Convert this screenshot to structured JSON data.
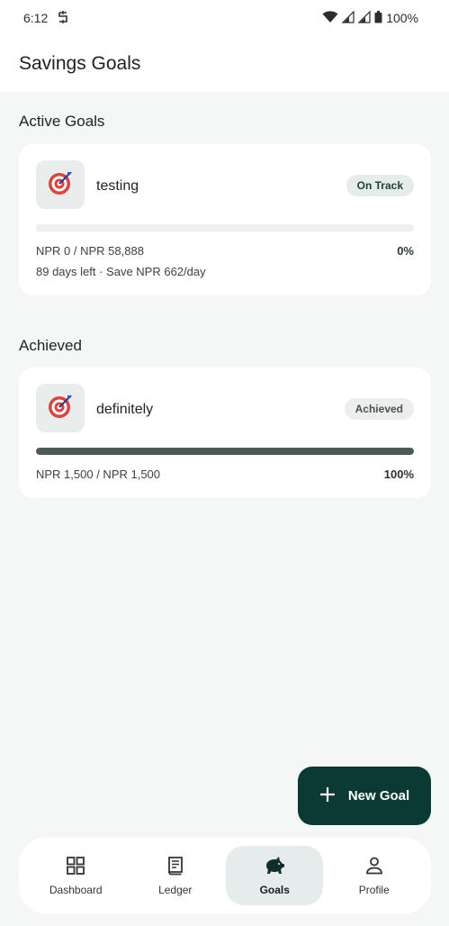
{
  "status_bar": {
    "time": "6:12",
    "battery": "100%",
    "icons": [
      "sync-icon",
      "wifi-icon",
      "signal-icon",
      "signal-icon",
      "battery-icon"
    ]
  },
  "header": {
    "title": "Savings Goals"
  },
  "sections": {
    "active_title": "Active Goals",
    "achieved_title": "Achieved"
  },
  "active_goals": [
    {
      "name": "testing",
      "icon": "target-icon",
      "status": "On Track",
      "progress": 0,
      "amount": "NPR 0 / NPR 58,888",
      "percent": "0%",
      "meta": "89 days left · Save NPR 662/day"
    }
  ],
  "achieved_goals": [
    {
      "name": "definitely",
      "icon": "target-icon",
      "status": "Achieved",
      "progress": 1,
      "amount": "NPR 1,500 / NPR 1,500",
      "percent": "100%"
    }
  ],
  "fab": {
    "label": "New Goal",
    "icon": "plus-icon"
  },
  "nav": {
    "items": [
      {
        "label": "Dashboard",
        "icon": "grid-icon",
        "active": false
      },
      {
        "label": "Ledger",
        "icon": "receipt-icon",
        "active": false
      },
      {
        "label": "Goals",
        "icon": "piggy-bank-icon",
        "active": true
      },
      {
        "label": "Profile",
        "icon": "person-icon",
        "active": false
      }
    ]
  },
  "colors": {
    "accent": "#0b3a35",
    "background": "#f4f7f6",
    "progress": "#4a5b56"
  }
}
